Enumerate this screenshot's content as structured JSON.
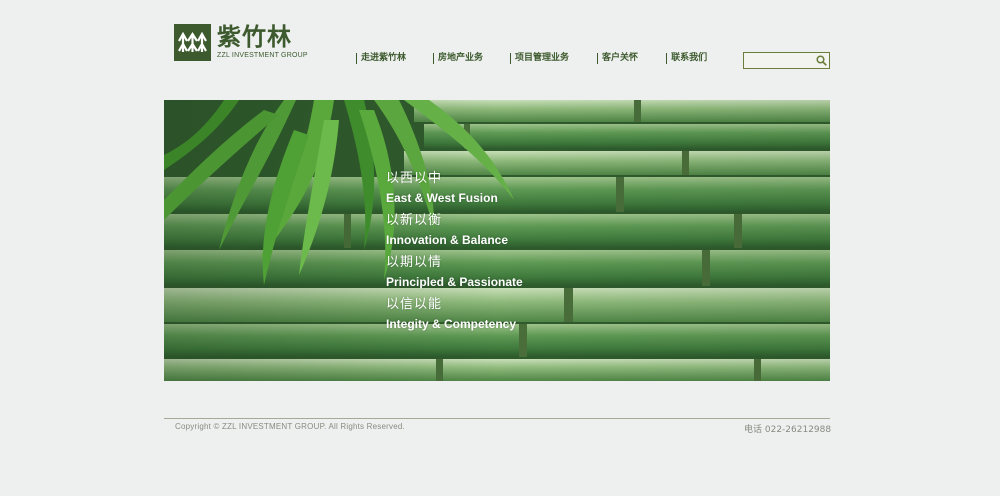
{
  "logo": {
    "name_cn": "紫竹林",
    "name_en": "ZZL INVESTMENT GROUP",
    "mark_icon": "bamboo-grid-icon",
    "color": "#3d5a2e"
  },
  "nav": {
    "items": [
      {
        "label": "走进紫竹林"
      },
      {
        "label": "房地产业务"
      },
      {
        "label": "项目管理业务"
      },
      {
        "label": "客户关怀"
      },
      {
        "label": "联系我们"
      }
    ]
  },
  "search": {
    "value": "",
    "placeholder": "",
    "icon": "search-icon"
  },
  "banner": {
    "image": "bamboo-stalks-photo",
    "mottos": [
      {
        "cn": "以西以中",
        "en": "East & West Fusion"
      },
      {
        "cn": "以新以衡",
        "en": "Innovation & Balance"
      },
      {
        "cn": "以期以情",
        "en": "Principled & Passionate"
      },
      {
        "cn": "以信以能",
        "en": "Integity & Competency"
      }
    ]
  },
  "footer": {
    "copyright": "Copyright ©  ZZL INVESTMENT GROUP. All Rights Reserved.",
    "phone": "电话 022-26212988"
  }
}
